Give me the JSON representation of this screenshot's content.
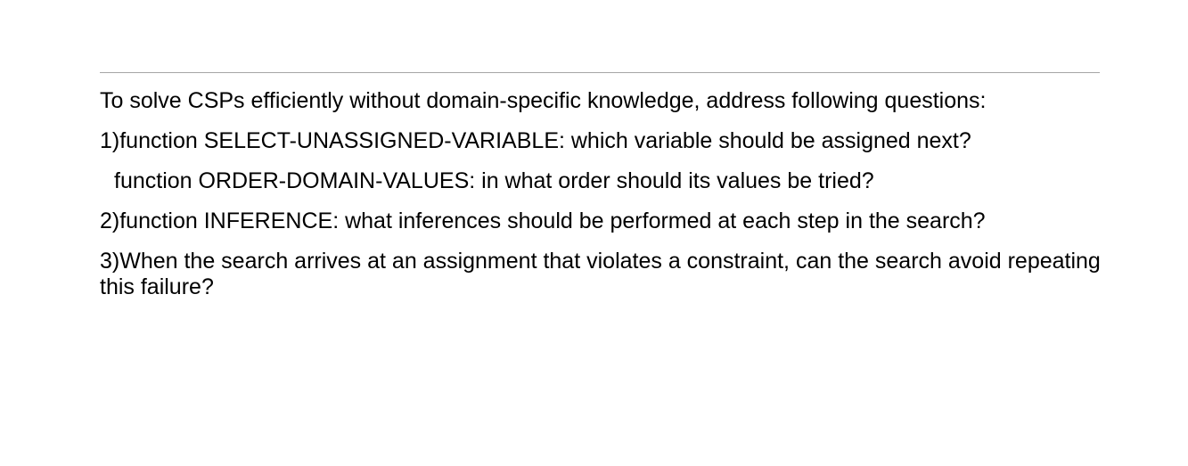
{
  "slide": {
    "paragraphs": [
      "To solve CSPs efficiently without domain-specific knowledge, address following questions:",
      "1)function SELECT-UNASSIGNED-VARIABLE: which variable should be assigned next?",
      "function ORDER-DOMAIN-VALUES: in what order should its values be tried?",
      "2)function INFERENCE: what inferences should be performed at each step in the search?",
      "3)When the search arrives at an assignment that violates a constraint, can the search avoid repeating this failure?"
    ]
  }
}
